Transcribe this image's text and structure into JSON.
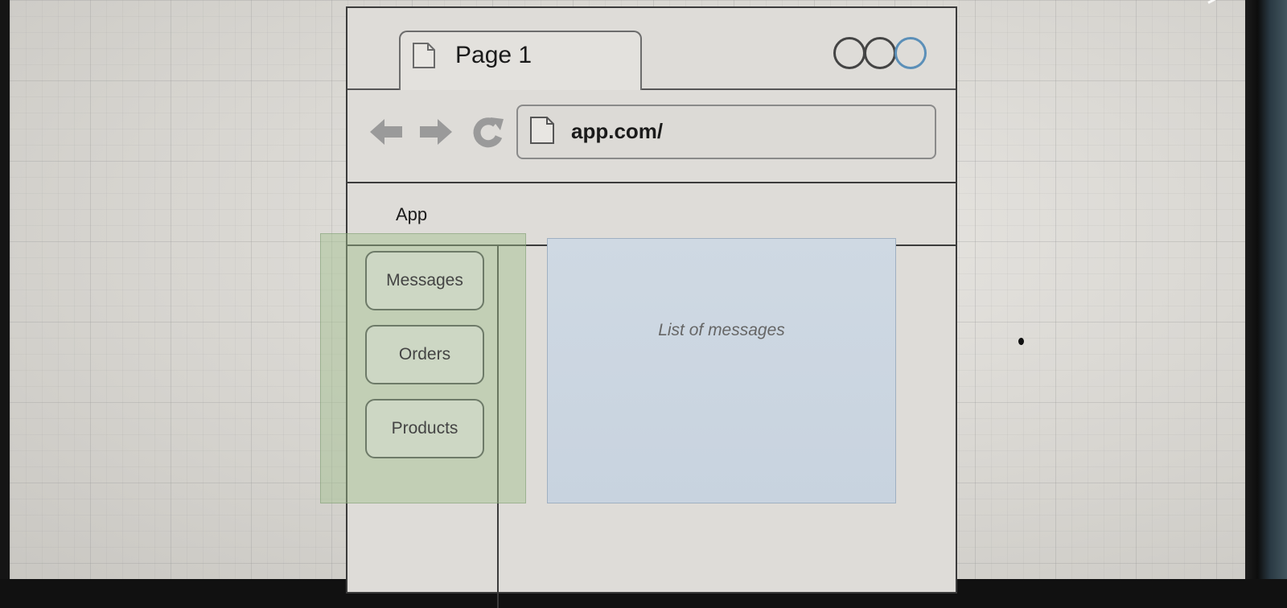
{
  "browser": {
    "tab": {
      "title": "Page 1",
      "icon": "page-icon"
    },
    "window_controls": [
      "circle-icon",
      "circle-icon",
      "circle-icon"
    ],
    "toolbar": {
      "back_icon": "arrow-left-icon",
      "forward_icon": "arrow-right-icon",
      "reload_icon": "reload-icon",
      "url": "app.com/",
      "url_icon": "page-icon"
    }
  },
  "app": {
    "title": "App",
    "sidebar": {
      "items": [
        {
          "label": "Messages"
        },
        {
          "label": "Orders"
        },
        {
          "label": "Products"
        }
      ]
    },
    "content": {
      "text": "List of messages"
    }
  },
  "colors": {
    "sidebar_overlay": "#a0be8c",
    "content_panel": "#cbd6e1",
    "active_control": "#5b8fb8"
  }
}
